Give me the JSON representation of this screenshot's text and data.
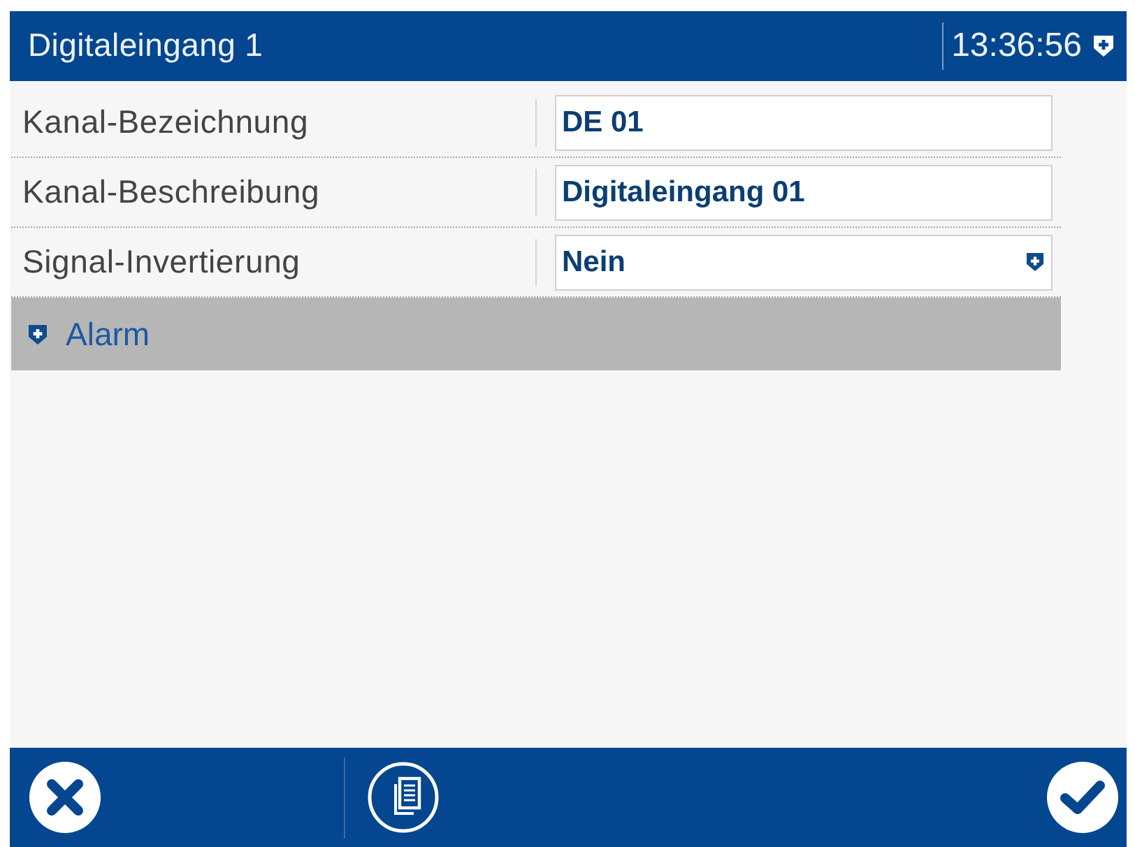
{
  "header": {
    "title": "Digitaleingang 1",
    "time": "13:36:56"
  },
  "fields": [
    {
      "kind": "text",
      "label": "Kanal-Bezeichnung",
      "value": "DE 01"
    },
    {
      "kind": "text",
      "label": "Kanal-Beschreibung",
      "value": "Digitaleingang 01"
    },
    {
      "kind": "select",
      "label": "Signal-Invertierung",
      "value": "Nein"
    }
  ],
  "sections": [
    {
      "label": "Alarm",
      "expanded": false
    }
  ]
}
